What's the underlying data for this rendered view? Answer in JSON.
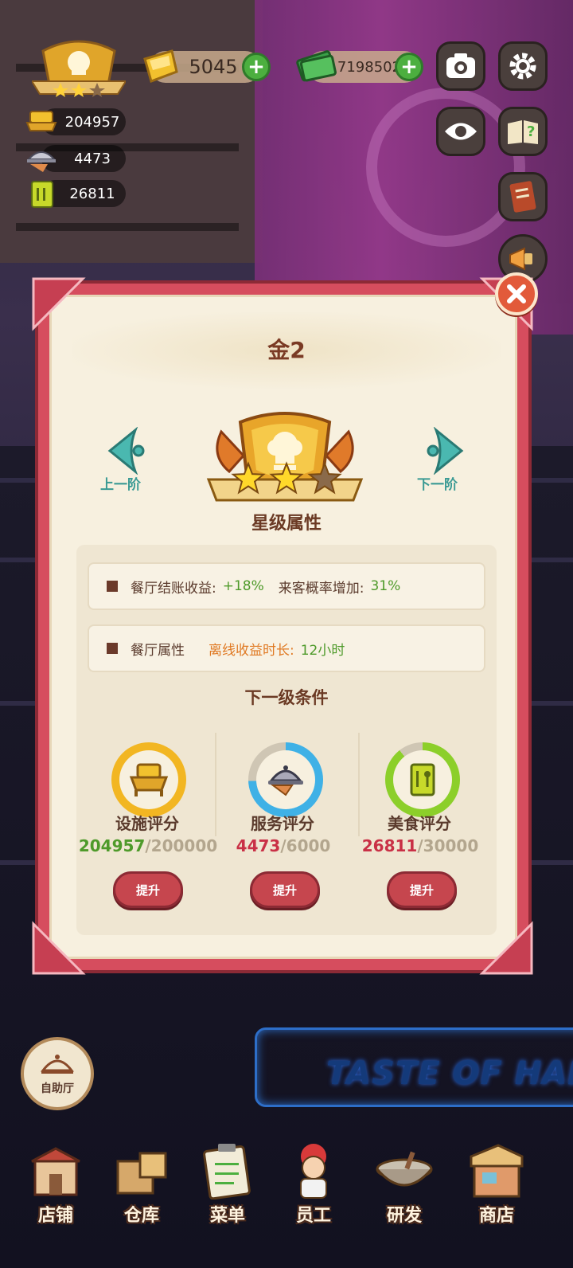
{
  "hud": {
    "gems": "5045",
    "cash": "7198502",
    "stats": [
      {
        "icon": "facility-icon",
        "value": "204957"
      },
      {
        "icon": "service-icon",
        "value": "4473"
      },
      {
        "icon": "food-book-icon",
        "value": "26811"
      }
    ]
  },
  "dialog": {
    "title": "金2",
    "prev_label": "上一阶",
    "next_label": "下一阶",
    "stars_filled": 2,
    "stars_total": 3,
    "section_title": "星级属性",
    "attr1_label": "餐厅结账收益:",
    "attr1_value": "+18%",
    "attr2_label": "来客概率增加:",
    "attr2_value": "31%",
    "attr3_label": "餐厅属性",
    "attr3_name": "离线收益时长:",
    "attr3_value": "12小时",
    "conditions_title": "下一级条件",
    "conditions": [
      {
        "label": "设施评分",
        "current": "204957",
        "target": "/200000",
        "progress": 1.0,
        "color": "#f2b622",
        "button": "提升"
      },
      {
        "label": "服务评分",
        "current": "4473",
        "target": "/6000",
        "progress": 0.7455,
        "color": "#3fb1e6",
        "button": "提升"
      },
      {
        "label": "美食评分",
        "current": "26811",
        "target": "/30000",
        "progress": 0.8937,
        "color": "#8ccf2a",
        "button": "提升"
      }
    ]
  },
  "buffet_label": "自助厅",
  "neon_sign": "TASTE OF HAPPIN",
  "bottom_nav": [
    "店铺",
    "仓库",
    "菜单",
    "员工",
    "研发",
    "商店"
  ],
  "colors": {
    "dialog_frame": "#d64d5e",
    "dialog_bg": "#f7f0df",
    "accent_green": "#4e9a2a",
    "accent_red": "#c93046"
  }
}
